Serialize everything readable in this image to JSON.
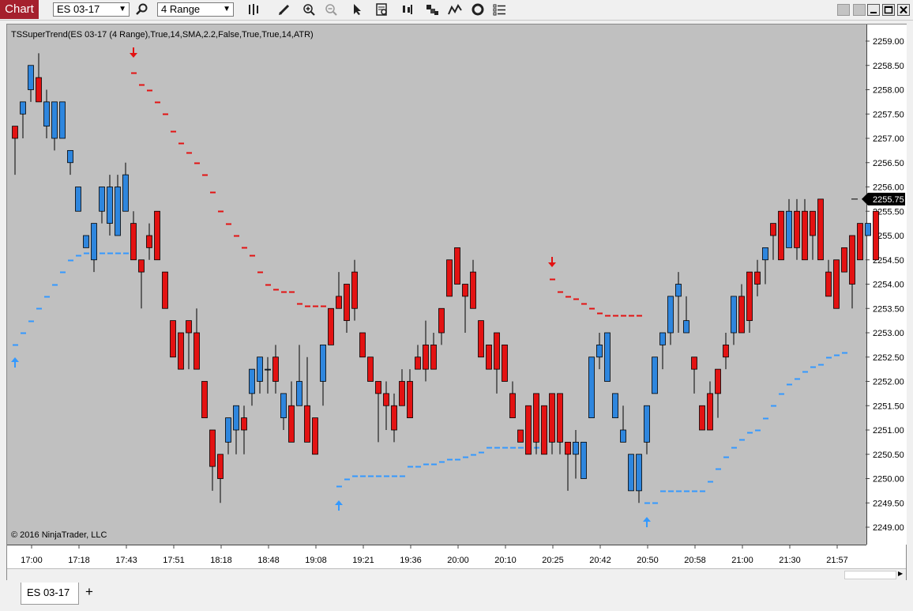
{
  "toolbar": {
    "chart_tab_label": "Chart",
    "instrument": "ES 03-17",
    "bar_type": "4 Range",
    "icons": [
      "search-icon",
      "bar-style-icon",
      "drawing-pencil-icon",
      "zoom-in-icon",
      "zoom-out-icon",
      "pointer-icon",
      "data-box-icon",
      "bar-spacing-icon",
      "chart-trader-icon",
      "indicators-icon",
      "strategies-icon",
      "properties-icon"
    ],
    "window_buttons": [
      "minimize-button",
      "maximize-button",
      "close-button"
    ]
  },
  "chart": {
    "indicator_label": "TSSuperTrend(ES 03-17 (4 Range),True,14,SMA,2.2,False,True,True,14,ATR)",
    "copyright": "© 2016 NinjaTrader, LLC",
    "current_price_label": "2255.75",
    "colors": {
      "background": "#c0c0c0",
      "up_bar": "#2e86de",
      "down_bar": "#e31212",
      "uptrend_line": "#3399ff",
      "downtrend_line": "#e31212"
    }
  },
  "chart_data": {
    "type": "candlestick",
    "title": "TSSuperTrend(ES 03-17 (4 Range),True,14,SMA,2.2,False,True,True,14,ATR)",
    "ylim": [
      2248.75,
      2259.25
    ],
    "y_ticks": [
      "2259.00",
      "2258.50",
      "2258.00",
      "2257.50",
      "2257.00",
      "2256.50",
      "2256.00",
      "2255.50",
      "2255.00",
      "2254.50",
      "2254.00",
      "2253.50",
      "2253.00",
      "2252.50",
      "2252.00",
      "2251.50",
      "2251.00",
      "2250.50",
      "2250.00",
      "2249.50",
      "2249.00"
    ],
    "x_ticks": [
      "17:00",
      "17:18",
      "17:43",
      "17:51",
      "18:18",
      "18:48",
      "19:08",
      "19:21",
      "19:36",
      "20:00",
      "20:10",
      "20:25",
      "20:42",
      "20:50",
      "20:58",
      "21:00",
      "21:30",
      "21:57"
    ],
    "x_tick_bar_index": [
      2,
      8,
      14,
      20,
      26,
      32,
      38,
      44,
      50,
      56,
      62,
      68,
      74,
      80,
      86,
      92,
      98,
      104
    ],
    "candles": [
      [
        2257.25,
        2257.0,
        2257.25,
        2256.25
      ],
      [
        2257.5,
        2257.75,
        2257.5,
        2257.0
      ],
      [
        2258.0,
        2258.5,
        2258.5,
        2257.75
      ],
      [
        2258.25,
        2257.75,
        2258.75,
        2257.75
      ],
      [
        2257.25,
        2257.75,
        2258.0,
        2257.0
      ],
      [
        2257.0,
        2257.75,
        2257.75,
        2256.75
      ],
      [
        2257.0,
        2257.75,
        2257.75,
        2257.0
      ],
      [
        2256.5,
        2256.75,
        2256.75,
        2256.25
      ],
      [
        2255.5,
        2256.0,
        2256.0,
        2255.5
      ],
      [
        2254.75,
        2255.0,
        2255.0,
        2254.75
      ],
      [
        2254.5,
        2255.25,
        2255.25,
        2254.25
      ],
      [
        2255.5,
        2256.0,
        2256.0,
        2255.25
      ],
      [
        2255.25,
        2256.0,
        2256.25,
        2255.0
      ],
      [
        2255.0,
        2256.0,
        2256.25,
        2255.0
      ],
      [
        2255.5,
        2256.25,
        2256.5,
        2255.5
      ],
      [
        2255.25,
        2254.5,
        2255.5,
        2254.5
      ],
      [
        2254.5,
        2254.25,
        2254.5,
        2253.5
      ],
      [
        2255.0,
        2254.75,
        2255.25,
        2254.5
      ],
      [
        2255.5,
        2254.5,
        2255.5,
        2254.5
      ],
      [
        2254.25,
        2253.5,
        2254.25,
        2253.5
      ],
      [
        2253.25,
        2252.5,
        2253.25,
        2252.5
      ],
      [
        2253.0,
        2252.25,
        2253.0,
        2252.25
      ],
      [
        2253.25,
        2253.0,
        2253.25,
        2252.25
      ],
      [
        2253.0,
        2252.25,
        2253.5,
        2252.25
      ],
      [
        2252.0,
        2251.25,
        2252.0,
        2251.25
      ],
      [
        2251.0,
        2250.25,
        2251.0,
        2249.75
      ],
      [
        2250.5,
        2250.0,
        2250.5,
        2249.5
      ],
      [
        2250.75,
        2251.25,
        2251.25,
        2250.5
      ],
      [
        2251.0,
        2251.5,
        2251.5,
        2250.5
      ],
      [
        2251.25,
        2251.0,
        2251.5,
        2250.5
      ],
      [
        2251.75,
        2252.25,
        2252.25,
        2251.5
      ],
      [
        2252.0,
        2252.5,
        2252.5,
        2251.75
      ],
      [
        2252.25,
        2252.25,
        2252.5,
        2251.75
      ],
      [
        2252.5,
        2252.0,
        2252.75,
        2251.75
      ],
      [
        2251.25,
        2251.75,
        2251.75,
        2251.0
      ],
      [
        2251.5,
        2250.75,
        2252.0,
        2250.75
      ],
      [
        2251.5,
        2252.0,
        2252.75,
        2251.5
      ],
      [
        2251.5,
        2250.75,
        2252.5,
        2250.75
      ],
      [
        2251.25,
        2250.5,
        2251.25,
        2250.5
      ],
      [
        2252.0,
        2252.75,
        2252.75,
        2251.5
      ],
      [
        2253.5,
        2252.75,
        2253.5,
        2252.75
      ],
      [
        2253.75,
        2253.5,
        2254.25,
        2253.5
      ],
      [
        2254.0,
        2253.25,
        2254.0,
        2253.0
      ],
      [
        2254.25,
        2253.5,
        2254.5,
        2253.25
      ],
      [
        2253.0,
        2252.5,
        2253.0,
        2252.5
      ],
      [
        2252.5,
        2252.0,
        2252.5,
        2252.0
      ],
      [
        2252.0,
        2251.75,
        2252.0,
        2250.75
      ],
      [
        2251.75,
        2251.5,
        2252.0,
        2251.0
      ],
      [
        2251.5,
        2251.0,
        2251.75,
        2250.75
      ],
      [
        2252.0,
        2251.5,
        2252.25,
        2251.5
      ],
      [
        2252.0,
        2251.25,
        2252.25,
        2251.25
      ],
      [
        2252.5,
        2252.25,
        2252.75,
        2252.25
      ],
      [
        2252.75,
        2252.25,
        2253.25,
        2252.0
      ],
      [
        2252.75,
        2252.25,
        2253.0,
        2252.25
      ],
      [
        2253.5,
        2253.0,
        2253.5,
        2252.75
      ],
      [
        2254.5,
        2253.75,
        2254.5,
        2253.75
      ],
      [
        2254.75,
        2254.0,
        2254.75,
        2254.0
      ],
      [
        2254.0,
        2253.75,
        2254.0,
        2253.0
      ],
      [
        2254.25,
        2253.5,
        2254.5,
        2253.5
      ],
      [
        2253.25,
        2252.5,
        2253.25,
        2252.5
      ],
      [
        2252.75,
        2252.25,
        2252.75,
        2252.25
      ],
      [
        2253.0,
        2252.25,
        2253.0,
        2251.75
      ],
      [
        2252.75,
        2252.0,
        2252.75,
        2252.0
      ],
      [
        2251.75,
        2251.25,
        2252.0,
        2251.25
      ],
      [
        2251.0,
        2250.75,
        2251.0,
        2250.75
      ],
      [
        2251.5,
        2250.5,
        2251.5,
        2250.5
      ],
      [
        2251.75,
        2250.75,
        2251.75,
        2250.5
      ],
      [
        2251.5,
        2250.5,
        2251.5,
        2250.5
      ],
      [
        2251.75,
        2250.75,
        2251.75,
        2250.5
      ],
      [
        2251.75,
        2250.75,
        2251.75,
        2250.5
      ],
      [
        2250.75,
        2250.5,
        2250.75,
        2249.75
      ],
      [
        2250.5,
        2250.75,
        2251.0,
        2250.0
      ],
      [
        2250.0,
        2250.75,
        2250.75,
        2250.0
      ],
      [
        2251.25,
        2252.5,
        2252.5,
        2251.25
      ],
      [
        2252.5,
        2252.75,
        2253.0,
        2252.25
      ],
      [
        2252.0,
        2253.0,
        2253.0,
        2252.0
      ],
      [
        2251.25,
        2251.75,
        2251.75,
        2251.25
      ],
      [
        2250.75,
        2251.0,
        2251.5,
        2250.75
      ],
      [
        2249.75,
        2250.5,
        2250.5,
        2249.75
      ],
      [
        2249.75,
        2250.5,
        2250.5,
        2249.5
      ],
      [
        2250.75,
        2251.5,
        2251.5,
        2250.5
      ],
      [
        2251.75,
        2252.5,
        2252.5,
        2251.75
      ],
      [
        2252.75,
        2253.0,
        2253.0,
        2252.25
      ],
      [
        2253.0,
        2253.75,
        2253.75,
        2252.75
      ],
      [
        2253.75,
        2254.0,
        2254.25,
        2253.0
      ],
      [
        2253.0,
        2253.25,
        2253.75,
        2253.0
      ],
      [
        2252.5,
        2252.25,
        2252.5,
        2251.75
      ],
      [
        2251.5,
        2251.0,
        2251.5,
        2251.0
      ],
      [
        2251.75,
        2251.0,
        2252.0,
        2251.0
      ],
      [
        2252.25,
        2251.75,
        2252.25,
        2251.25
      ],
      [
        2252.75,
        2252.5,
        2253.0,
        2252.25
      ],
      [
        2253.0,
        2253.75,
        2253.75,
        2252.75
      ],
      [
        2253.75,
        2253.0,
        2254.0,
        2253.0
      ],
      [
        2254.25,
        2253.25,
        2254.25,
        2253.0
      ],
      [
        2254.25,
        2254.0,
        2254.5,
        2253.75
      ],
      [
        2254.5,
        2254.75,
        2254.75,
        2254.0
      ],
      [
        2255.25,
        2255.0,
        2255.25,
        2254.5
      ],
      [
        2255.5,
        2254.5,
        2255.5,
        2254.5
      ],
      [
        2254.75,
        2255.5,
        2255.75,
        2254.75
      ],
      [
        2255.5,
        2254.75,
        2255.75,
        2254.5
      ],
      [
        2255.5,
        2254.5,
        2255.75,
        2254.5
      ],
      [
        2255.5,
        2255.0,
        2255.5,
        2254.5
      ],
      [
        2255.75,
        2254.5,
        2255.75,
        2254.5
      ],
      [
        2254.25,
        2253.75,
        2254.5,
        2253.75
      ],
      [
        2254.5,
        2253.5,
        2254.5,
        2253.5
      ],
      [
        2254.75,
        2254.25,
        2254.75,
        2254.25
      ],
      [
        2255.0,
        2254.0,
        2255.0,
        2253.5
      ],
      [
        2255.25,
        2254.5,
        2255.25,
        2254.5
      ],
      [
        2255.0,
        2255.25,
        2255.25,
        2255.0
      ],
      [
        2255.5,
        2254.5,
        2255.5,
        2254.5
      ]
    ],
    "supertrend_up": [
      [
        0,
        2252.75
      ],
      [
        1,
        2253.0
      ],
      [
        2,
        2253.25
      ],
      [
        3,
        2253.5
      ],
      [
        4,
        2253.75
      ],
      [
        5,
        2254.0
      ],
      [
        6,
        2254.25
      ],
      [
        7,
        2254.5
      ],
      [
        8,
        2254.6
      ],
      [
        9,
        2254.65
      ],
      [
        10,
        2254.65
      ],
      [
        11,
        2254.65
      ],
      [
        12,
        2254.65
      ],
      [
        13,
        2254.65
      ],
      [
        14,
        2254.65
      ],
      [
        41,
        2249.85
      ],
      [
        42,
        2250.0
      ],
      [
        43,
        2250.05
      ],
      [
        44,
        2250.05
      ],
      [
        45,
        2250.05
      ],
      [
        46,
        2250.05
      ],
      [
        47,
        2250.05
      ],
      [
        48,
        2250.05
      ],
      [
        49,
        2250.05
      ],
      [
        50,
        2250.25
      ],
      [
        51,
        2250.25
      ],
      [
        52,
        2250.3
      ],
      [
        53,
        2250.3
      ],
      [
        54,
        2250.35
      ],
      [
        55,
        2250.4
      ],
      [
        56,
        2250.4
      ],
      [
        57,
        2250.45
      ],
      [
        58,
        2250.5
      ],
      [
        59,
        2250.55
      ],
      [
        60,
        2250.65
      ],
      [
        61,
        2250.65
      ],
      [
        62,
        2250.65
      ],
      [
        63,
        2250.65
      ],
      [
        64,
        2250.65
      ],
      [
        65,
        2250.65
      ],
      [
        66,
        2250.65
      ],
      [
        67,
        2250.65
      ],
      [
        80,
        2249.5
      ],
      [
        81,
        2249.5
      ],
      [
        82,
        2249.75
      ],
      [
        83,
        2249.75
      ],
      [
        84,
        2249.75
      ],
      [
        85,
        2249.75
      ],
      [
        86,
        2249.75
      ],
      [
        87,
        2249.75
      ],
      [
        88,
        2249.95
      ],
      [
        89,
        2250.2
      ],
      [
        90,
        2250.45
      ],
      [
        91,
        2250.65
      ],
      [
        92,
        2250.8
      ],
      [
        93,
        2250.95
      ],
      [
        94,
        2251.0
      ],
      [
        95,
        2251.25
      ],
      [
        96,
        2251.5
      ],
      [
        97,
        2251.75
      ],
      [
        98,
        2251.95
      ],
      [
        99,
        2252.05
      ],
      [
        100,
        2252.2
      ],
      [
        101,
        2252.3
      ],
      [
        102,
        2252.35
      ],
      [
        103,
        2252.5
      ],
      [
        104,
        2252.55
      ],
      [
        105,
        2252.6
      ]
    ],
    "supertrend_down": [
      [
        15,
        2258.35
      ],
      [
        16,
        2258.1
      ],
      [
        17,
        2258.0
      ],
      [
        18,
        2257.75
      ],
      [
        19,
        2257.5
      ],
      [
        20,
        2257.15
      ],
      [
        21,
        2256.9
      ],
      [
        22,
        2256.7
      ],
      [
        23,
        2256.5
      ],
      [
        24,
        2256.25
      ],
      [
        25,
        2255.9
      ],
      [
        26,
        2255.5
      ],
      [
        27,
        2255.25
      ],
      [
        28,
        2255.0
      ],
      [
        29,
        2254.75
      ],
      [
        30,
        2254.6
      ],
      [
        31,
        2254.25
      ],
      [
        32,
        2254.0
      ],
      [
        33,
        2253.9
      ],
      [
        34,
        2253.85
      ],
      [
        35,
        2253.85
      ],
      [
        36,
        2253.6
      ],
      [
        37,
        2253.55
      ],
      [
        38,
        2253.55
      ],
      [
        39,
        2253.55
      ],
      [
        68,
        2254.1
      ],
      [
        69,
        2253.85
      ],
      [
        70,
        2253.75
      ],
      [
        71,
        2253.7
      ],
      [
        72,
        2253.6
      ],
      [
        73,
        2253.5
      ],
      [
        74,
        2253.4
      ],
      [
        75,
        2253.35
      ],
      [
        76,
        2253.35
      ],
      [
        77,
        2253.35
      ],
      [
        78,
        2253.35
      ],
      [
        79,
        2253.35
      ]
    ],
    "buy_arrows": [
      0,
      41,
      80
    ],
    "sell_arrows": [
      15,
      68
    ],
    "last_price": 2255.75
  },
  "bottom": {
    "instrument_tab": "ES 03-17",
    "add_tab_label": "+"
  }
}
